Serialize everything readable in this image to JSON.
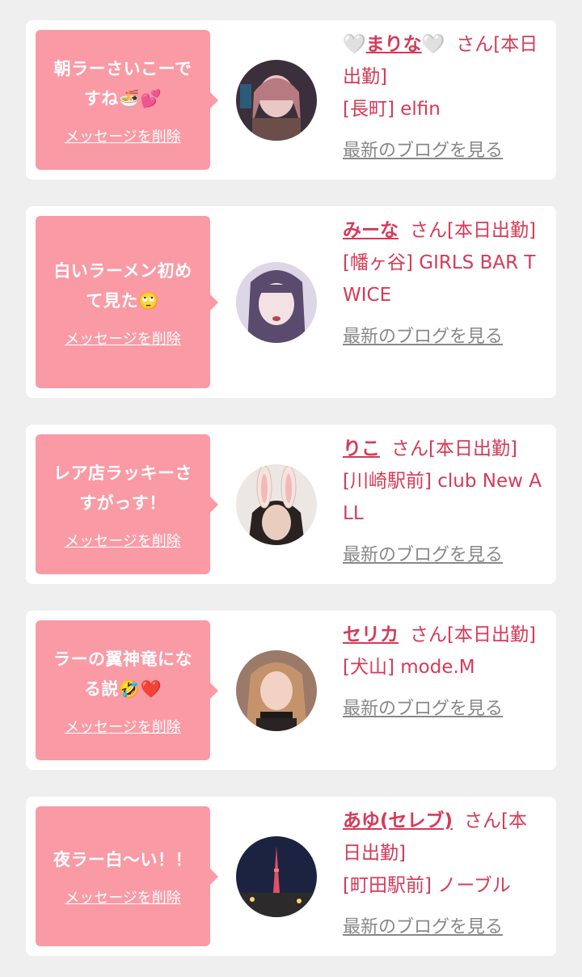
{
  "items": [
    {
      "message": "朝ラーさいこーですね🍜💕",
      "delete_label": "メッセージを削除",
      "name_prefix": "🤍",
      "name": "まりな",
      "name_suffix_icon": "🤍",
      "status": "さん[本日出勤]",
      "shop": "[長町] elfin",
      "blog_label": "最新のブログを見る"
    },
    {
      "message": "白いラーメン初めて見た🙄",
      "delete_label": "メッセージを削除",
      "name_prefix": "",
      "name": "みーな",
      "name_suffix_icon": "",
      "status": "さん[本日出勤]",
      "shop": "[幡ヶ谷] GIRLS BAR TWICE",
      "blog_label": "最新のブログを見る"
    },
    {
      "message": "レア店ラッキーさすがっす！",
      "delete_label": "メッセージを削除",
      "name_prefix": "",
      "name": "りこ",
      "name_suffix_icon": "",
      "status": "さん[本日出勤]",
      "shop": "[川崎駅前] club New ALL",
      "blog_label": "最新のブログを見る"
    },
    {
      "message": "ラーの翼神竜になる説🤣❤️",
      "delete_label": "メッセージを削除",
      "name_prefix": "",
      "name": "セリカ",
      "name_suffix_icon": "",
      "status": "さん[本日出勤]",
      "shop": "[犬山] mode.M",
      "blog_label": "最新のブログを見る"
    },
    {
      "message": "夜ラー白〜い！！",
      "delete_label": "メッセージを削除",
      "name_prefix": "",
      "name": "あゆ(セレブ)",
      "name_suffix_icon": "",
      "status": "さん[本日出勤]",
      "shop": "[町田駅前] ノーブル",
      "blog_label": "最新のブログを見る"
    }
  ],
  "colors": {
    "page_bg": "#efefef",
    "card_bg": "#ffffff",
    "bubble_bg": "#f99aa5",
    "name_color": "#d63a57",
    "blog_link_color": "#888888"
  }
}
